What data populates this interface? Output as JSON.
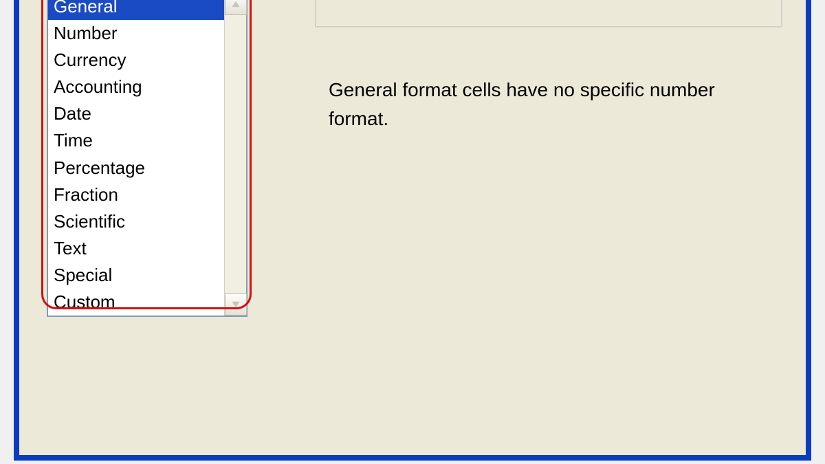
{
  "categoryList": {
    "selectedIndex": 0,
    "items": [
      {
        "label": "General"
      },
      {
        "label": "Number"
      },
      {
        "label": "Currency"
      },
      {
        "label": "Accounting"
      },
      {
        "label": "Date"
      },
      {
        "label": "Time"
      },
      {
        "label": "Percentage"
      },
      {
        "label": "Fraction"
      },
      {
        "label": "Scientific"
      },
      {
        "label": "Text"
      },
      {
        "label": "Special"
      },
      {
        "label": "Custom"
      }
    ]
  },
  "description": {
    "text": "General format cells have no specific number format."
  },
  "colors": {
    "windowFrame": "#0a3cc0",
    "dialogBg": "#ece9d8",
    "selectionBg": "#1a4bc4",
    "annotationRed": "#d21010"
  }
}
